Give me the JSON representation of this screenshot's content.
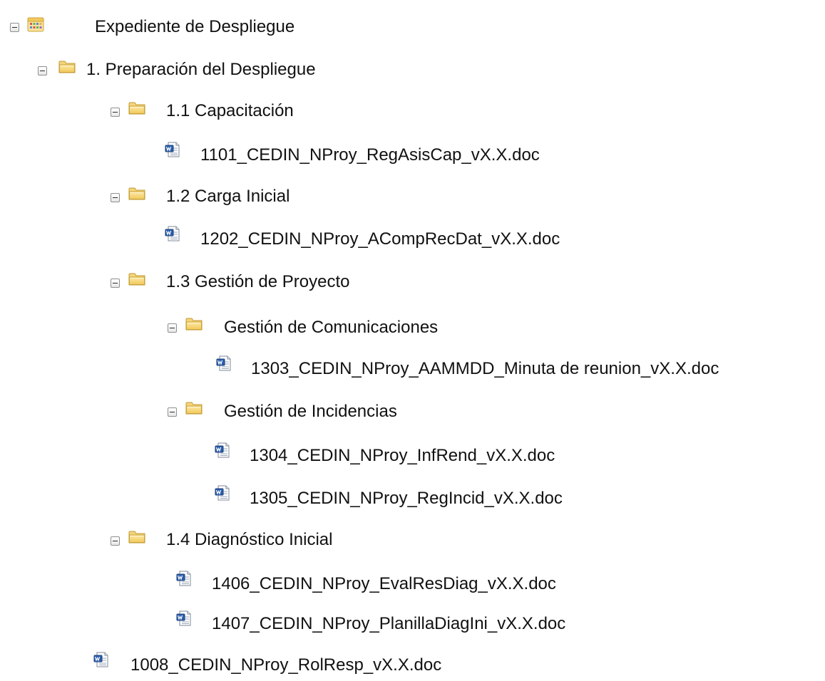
{
  "tree": {
    "root": {
      "label": "Expediente de Despliegue",
      "icon": "calendar-folder-icon",
      "expanded": true
    },
    "prep": {
      "label": "1. Preparación del Despliegue",
      "icon": "folder-icon",
      "expanded": true
    },
    "cap": {
      "label": "1.1 Capacitación",
      "icon": "folder-icon",
      "expanded": true
    },
    "cap_doc": {
      "label": "1101_CEDIN_NProy_RegAsisCap_vX.X.doc",
      "icon": "word-document-icon"
    },
    "carga": {
      "label": "1.2 Carga Inicial",
      "icon": "folder-icon",
      "expanded": true
    },
    "carga_doc": {
      "label": "1202_CEDIN_NProy_ACompRecDat_vX.X.doc",
      "icon": "word-document-icon"
    },
    "gestion": {
      "label": "1.3 Gestión de Proyecto",
      "icon": "folder-icon",
      "expanded": true
    },
    "comunic": {
      "label": "Gestión de Comunicaciones",
      "icon": "folder-icon",
      "expanded": true
    },
    "comunic_doc": {
      "label": "1303_CEDIN_NProy_AAMMDD_Minuta de reunion_vX.X.doc",
      "icon": "word-document-icon"
    },
    "incid": {
      "label": "Gestión de Incidencias",
      "icon": "folder-icon",
      "expanded": true
    },
    "incid_doc1": {
      "label": "1304_CEDIN_NProy_InfRend_vX.X.doc",
      "icon": "word-document-icon"
    },
    "incid_doc2": {
      "label": "1305_CEDIN_NProy_RegIncid_vX.X.doc",
      "icon": "word-document-icon"
    },
    "diag": {
      "label": "1.4 Diagnóstico Inicial",
      "icon": "folder-icon",
      "expanded": true
    },
    "diag_doc1": {
      "label": "1406_CEDIN_NProy_EvalResDiag_vX.X.doc",
      "icon": "word-document-icon"
    },
    "diag_doc2": {
      "label": "1407_CEDIN_NProy_PlanillaDiagIni_vX.X.doc",
      "icon": "word-document-icon"
    },
    "rol_doc": {
      "label": "1008_CEDIN_NProy_RolResp_vX.X.doc",
      "icon": "word-document-icon"
    }
  },
  "colors": {
    "folder_fill": "#f7d87a",
    "folder_edge": "#c9a43a",
    "word_blue": "#2b5fad",
    "toggle_border": "#8e8f8f"
  }
}
